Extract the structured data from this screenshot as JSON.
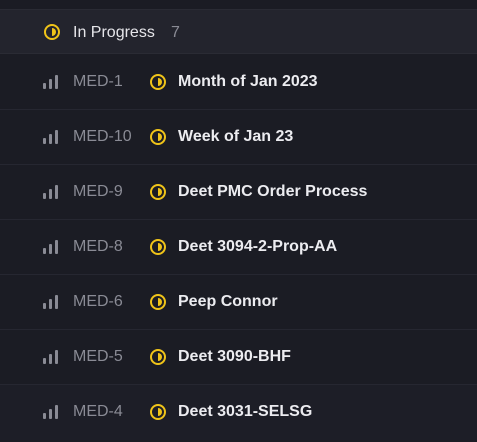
{
  "colors": {
    "background": "#1b1c24",
    "header_background": "#23242d",
    "status_in_progress": "#f0c419",
    "id_text": "#8a8b95",
    "title_text": "#ececf0"
  },
  "group": {
    "title": "In Progress",
    "count": "7",
    "status_icon": "in-progress-icon"
  },
  "issues": [
    {
      "id": "MED-1",
      "title": "Month of Jan 2023",
      "priority_icon": "priority-bars-icon",
      "status_icon": "in-progress-icon"
    },
    {
      "id": "MED-10",
      "title": "Week of Jan 23",
      "priority_icon": "priority-bars-icon",
      "status_icon": "in-progress-icon"
    },
    {
      "id": "MED-9",
      "title": "Deet PMC Order Process",
      "priority_icon": "priority-bars-icon",
      "status_icon": "in-progress-icon"
    },
    {
      "id": "MED-8",
      "title": "Deet 3094-2-Prop-AA",
      "priority_icon": "priority-bars-icon",
      "status_icon": "in-progress-icon"
    },
    {
      "id": "MED-6",
      "title": "Peep Connor",
      "priority_icon": "priority-bars-icon",
      "status_icon": "in-progress-icon"
    },
    {
      "id": "MED-5",
      "title": "Deet 3090-BHF",
      "priority_icon": "priority-bars-icon",
      "status_icon": "in-progress-icon"
    },
    {
      "id": "MED-4",
      "title": "Deet 3031-SELSG",
      "priority_icon": "priority-bars-icon",
      "status_icon": "in-progress-icon"
    }
  ]
}
